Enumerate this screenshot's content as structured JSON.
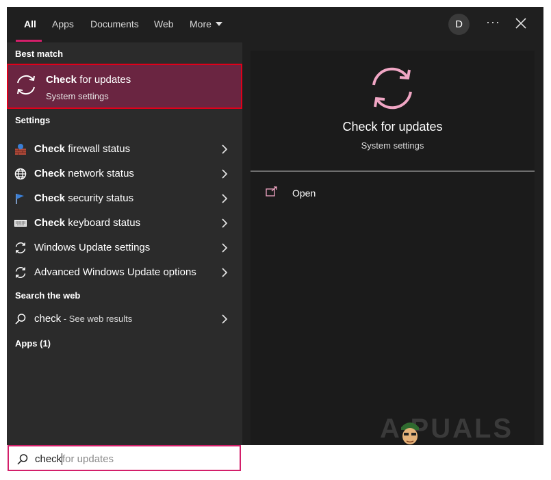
{
  "tabs": [
    "All",
    "Apps",
    "Documents",
    "Web",
    "More"
  ],
  "user_initial": "D",
  "more_options_glyph": "···",
  "sections": {
    "best_match": "Best match",
    "settings": "Settings",
    "search_web": "Search the web",
    "apps": "Apps (1)"
  },
  "best_match": {
    "title_bold": "Check",
    "title_rest": " for updates",
    "subtitle": "System settings",
    "icon": "sync-icon"
  },
  "settings_items": [
    {
      "bold": "Check",
      "rest": " firewall status",
      "icon": "firewall-icon"
    },
    {
      "bold": "Check",
      "rest": " network status",
      "icon": "globe-icon"
    },
    {
      "bold": "Check",
      "rest": " security status",
      "icon": "flag-icon"
    },
    {
      "bold": "Check",
      "rest": " keyboard status",
      "icon": "keyboard-icon"
    },
    {
      "bold": "",
      "rest": "Windows Update settings",
      "icon": "sync-icon"
    },
    {
      "bold": "",
      "rest": "Advanced Windows Update options",
      "icon": "sync-icon"
    }
  ],
  "web_result": {
    "query": "check",
    "suffix": " - See web results",
    "icon": "search-icon"
  },
  "preview": {
    "title": "Check for updates",
    "subtitle": "System settings",
    "action": "Open",
    "icon": "sync-icon"
  },
  "search": {
    "typed": "check",
    "ghost": " for updates",
    "icon": "search-icon"
  },
  "watermark": "A  PUALS",
  "colors": {
    "accent": "#d31f6a",
    "highlight_bg": "#6a2541",
    "highlight_border": "#e0001a",
    "icon_pink": "#f0a6c4"
  }
}
